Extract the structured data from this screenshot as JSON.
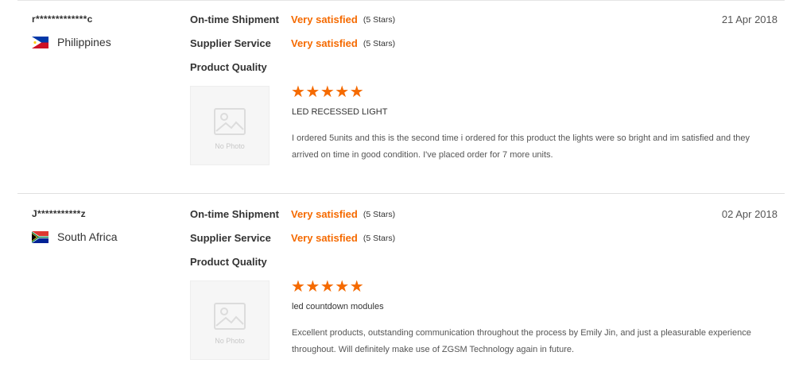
{
  "rating_labels": {
    "shipment": "On-time Shipment",
    "service": "Supplier Service",
    "quality": "Product Quality"
  },
  "no_photo": "No Photo",
  "accent_color": "#f56a00",
  "reviews": [
    {
      "buyer": "r*************c",
      "country": "Philippines",
      "flag_icon": "philippines-flag-icon",
      "date": "21 Apr 2018",
      "shipment_value": "Very satisfied",
      "shipment_stars": "(5 Stars)",
      "service_value": "Very satisfied",
      "service_stars": "(5 Stars)",
      "quality_rating": 5,
      "stars_glyph": "★★★★★",
      "product": "LED RECESSED LIGHT",
      "comment": "I ordered 5units and this is the second time i ordered for this product the lights were so bright and im satisfied and they arrived on time in good condition. I've placed order for 7 more units."
    },
    {
      "buyer": "J***********z",
      "country": "South Africa",
      "flag_icon": "south-africa-flag-icon",
      "date": "02 Apr 2018",
      "shipment_value": "Very satisfied",
      "shipment_stars": "(5 Stars)",
      "service_value": "Very satisfied",
      "service_stars": "(5 Stars)",
      "quality_rating": 5,
      "stars_glyph": "★★★★★",
      "product": "led countdown modules",
      "comment": "Excellent products, outstanding communication throughout the process by Emily Jin, and just a pleasurable experience throughout. Will definitely make use of ZGSM Technology again in future."
    }
  ]
}
